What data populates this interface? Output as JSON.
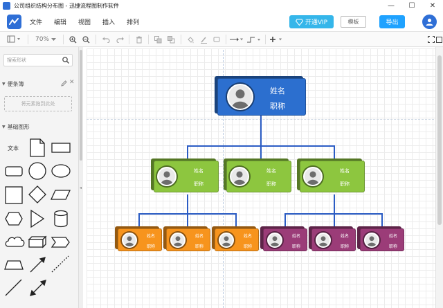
{
  "window": {
    "title": "公司组织结构分布图 - 迅捷流程图制作软件",
    "minimize": "—",
    "maximize": "☐",
    "close": "✕"
  },
  "menu": {
    "items": [
      "文件",
      "编辑",
      "视图",
      "插入",
      "排列"
    ]
  },
  "header": {
    "vip_label": "开通VIP",
    "template_label": "模板",
    "export_label": "导出"
  },
  "toolbar": {
    "zoom": "70%"
  },
  "sidebar": {
    "search_placeholder": "搜索形状",
    "scratchpad_title": "便条簿",
    "scratchpad_drop": "将元素拖到此处",
    "basic_shapes_title": "基础图形",
    "text_shape_label": "文本"
  },
  "colors": {
    "top": "#2c6fcf",
    "mid": "#8dc63f",
    "orange": "#f7941d",
    "purple": "#9b3c78",
    "connector": "#2b5cc4",
    "accent": "#1fa2ff"
  },
  "org": {
    "root": {
      "name": "姓名",
      "title": "职称"
    },
    "level2": [
      {
        "name": "姓名",
        "title": "职称"
      },
      {
        "name": "姓名",
        "title": "职称"
      },
      {
        "name": "姓名",
        "title": "职称"
      }
    ],
    "level3_orange": [
      {
        "name": "姓名",
        "title": "职称"
      },
      {
        "name": "姓名",
        "title": "职称"
      },
      {
        "name": "姓名",
        "title": "职称"
      }
    ],
    "level3_purple": [
      {
        "name": "姓名",
        "title": "职称"
      },
      {
        "name": "姓名",
        "title": "职称"
      },
      {
        "name": "姓名",
        "title": "职称"
      }
    ]
  }
}
